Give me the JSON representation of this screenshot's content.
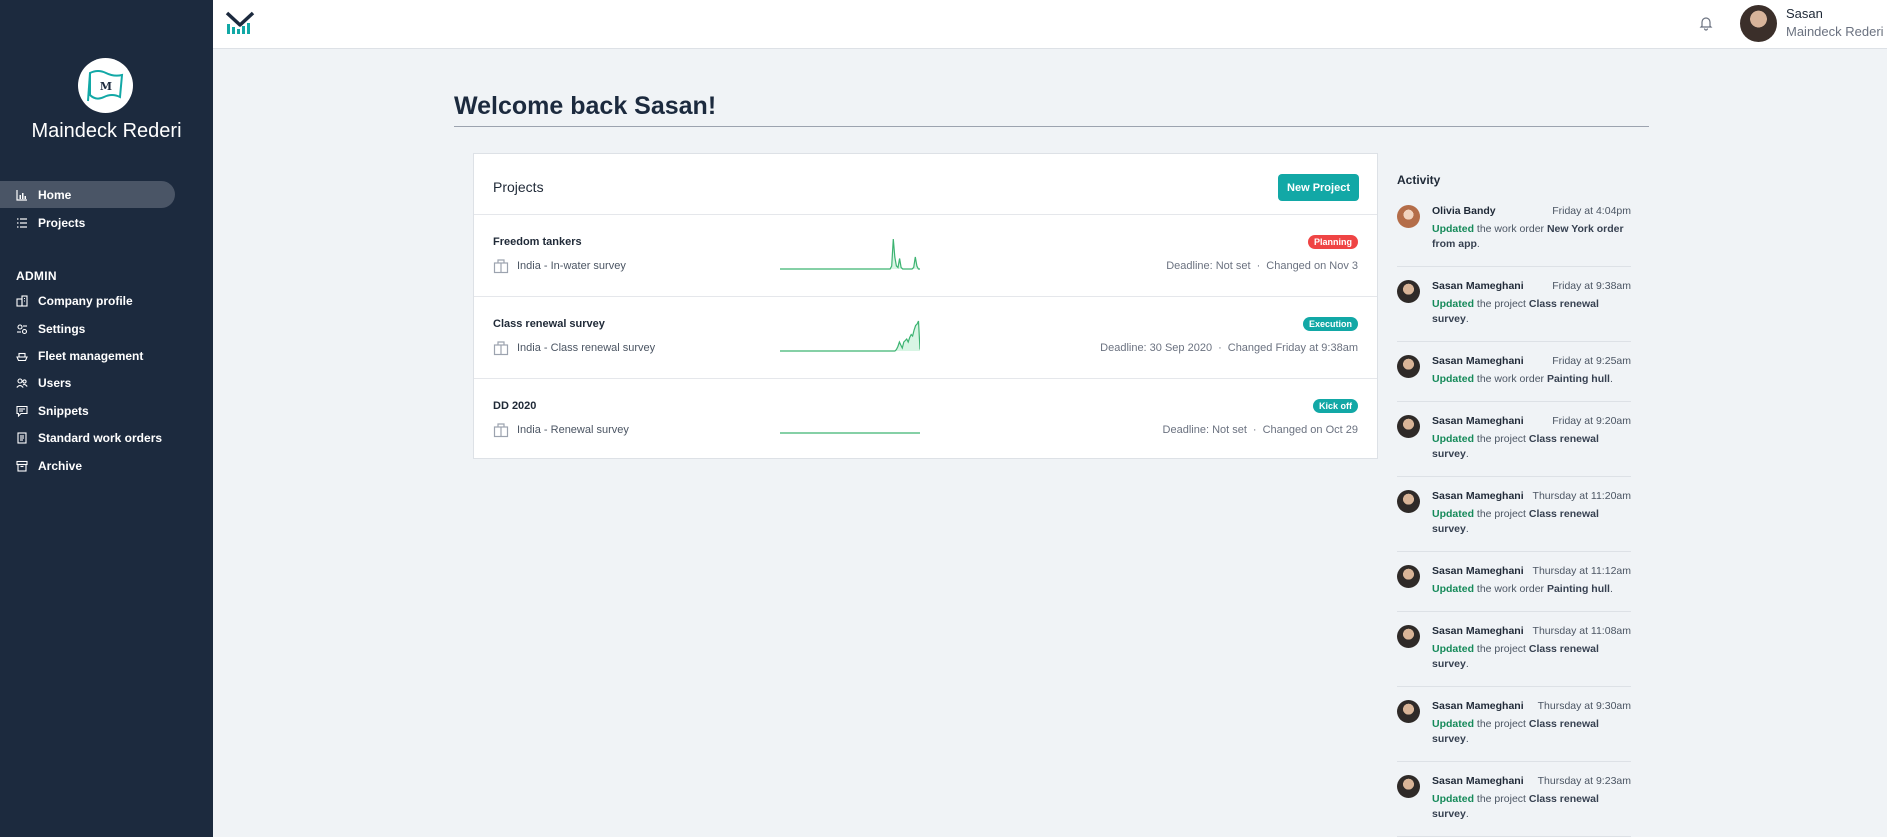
{
  "sidebar": {
    "brand_name": "Maindeck Rederi",
    "brand_letter": "M",
    "items": [
      {
        "label": "Home",
        "icon": "chart-bar-icon",
        "active": true
      },
      {
        "label": "Projects",
        "icon": "list-icon",
        "active": false
      }
    ],
    "admin_label": "ADMIN",
    "admin_items": [
      {
        "label": "Company profile",
        "icon": "building-icon"
      },
      {
        "label": "Settings",
        "icon": "settings-icon"
      },
      {
        "label": "Fleet management",
        "icon": "ship-icon"
      },
      {
        "label": "Users",
        "icon": "users-icon"
      },
      {
        "label": "Snippets",
        "icon": "message-icon"
      },
      {
        "label": "Standard work orders",
        "icon": "document-icon"
      },
      {
        "label": "Archive",
        "icon": "archive-icon"
      }
    ]
  },
  "topbar": {
    "user_name": "Sasan",
    "user_org": "Maindeck Rederi"
  },
  "welcome": "Welcome back Sasan!",
  "projects": {
    "title": "Projects",
    "new_button": "New Project",
    "rows": [
      {
        "name": "Freedom tankers",
        "subtitle": "India - In-water survey",
        "status": "Planning",
        "status_color": "#ef4444",
        "deadline": "Deadline: Not set",
        "changed": "Changed on Nov 3",
        "sparkline": [
          0,
          0,
          0,
          0,
          0,
          0,
          0,
          0,
          0,
          0,
          0,
          0,
          0,
          0,
          0,
          0,
          0,
          0,
          0,
          0,
          0,
          0,
          0,
          0,
          0,
          0,
          0,
          0,
          0,
          0,
          0,
          0,
          0,
          0,
          0,
          0,
          0,
          0,
          0,
          0,
          0,
          0,
          0,
          0,
          0,
          0,
          0,
          0,
          0,
          0,
          0,
          0,
          0,
          0,
          0,
          0,
          0,
          0,
          0,
          0,
          0,
          0,
          0,
          0,
          0,
          0,
          0,
          0,
          0,
          0,
          0,
          0.1,
          1,
          0.4,
          0.1,
          0.05,
          0.35,
          0.05,
          0,
          0,
          0,
          0,
          0,
          0,
          0,
          0.05,
          0.4,
          0.1,
          0,
          0
        ]
      },
      {
        "name": "Class renewal survey",
        "subtitle": "India - Class renewal survey",
        "status": "Execution",
        "status_color": "#12a8a6",
        "deadline": "Deadline: 30 Sep 2020",
        "changed": "Changed Friday at 9:38am",
        "sparkline": [
          0,
          0,
          0,
          0,
          0,
          0,
          0,
          0,
          0,
          0,
          0,
          0,
          0,
          0,
          0,
          0,
          0,
          0,
          0,
          0,
          0,
          0,
          0,
          0,
          0,
          0,
          0,
          0,
          0,
          0,
          0,
          0,
          0,
          0,
          0,
          0,
          0,
          0,
          0,
          0,
          0,
          0,
          0,
          0,
          0,
          0,
          0,
          0,
          0,
          0,
          0,
          0,
          0,
          0,
          0,
          0,
          0,
          0,
          0,
          0,
          0,
          0,
          0,
          0,
          0,
          0,
          0,
          0,
          0,
          0,
          0,
          0,
          0,
          0,
          0,
          0,
          0,
          0,
          0,
          0.05,
          0.15,
          0.3,
          0.2,
          0.1,
          0.3,
          0.35,
          0.4,
          0.3,
          0.45,
          0.55,
          0.5,
          0.7,
          0.85,
          0.9,
          1,
          0.05
        ]
      },
      {
        "name": "DD 2020",
        "subtitle": "India - Renewal survey",
        "status": "Kick off",
        "status_color": "#12a8a6",
        "deadline": "Deadline: Not set",
        "changed": "Changed on Oct 29",
        "sparkline": [
          0,
          0,
          0,
          0,
          0,
          0,
          0,
          0,
          0,
          0,
          0,
          0,
          0,
          0,
          0,
          0,
          0,
          0,
          0,
          0,
          0,
          0,
          0,
          0,
          0,
          0,
          0,
          0,
          0,
          0,
          0,
          0,
          0,
          0,
          0,
          0,
          0,
          0,
          0,
          0,
          0,
          0,
          0,
          0,
          0,
          0,
          0,
          0,
          0,
          0,
          0,
          0,
          0,
          0,
          0,
          0,
          0,
          0,
          0,
          0,
          0,
          0,
          0,
          0,
          0,
          0,
          0,
          0,
          0,
          0,
          0,
          0,
          0,
          0,
          0,
          0,
          0,
          0,
          0,
          0,
          0,
          0,
          0,
          0,
          0,
          0,
          0,
          0,
          0,
          0
        ]
      }
    ]
  },
  "activity": {
    "title": "Activity",
    "items": [
      {
        "name": "Olivia Bandy",
        "time": "Friday at 4:04pm",
        "avatar": "woman",
        "verb": "Updated",
        "pre": " the work order ",
        "target": "New York order from app",
        "post": "."
      },
      {
        "name": "Sasan Mameghani",
        "time": "Friday at 9:38am",
        "avatar": "man",
        "verb": "Updated",
        "pre": " the project ",
        "target": "Class renewal survey",
        "post": "."
      },
      {
        "name": "Sasan Mameghani",
        "time": "Friday at 9:25am",
        "avatar": "man",
        "verb": "Updated",
        "pre": " the work order ",
        "target": "Painting hull",
        "post": "."
      },
      {
        "name": "Sasan Mameghani",
        "time": "Friday at 9:20am",
        "avatar": "man",
        "verb": "Updated",
        "pre": " the project ",
        "target": "Class renewal survey",
        "post": "."
      },
      {
        "name": "Sasan Mameghani",
        "time": "Thursday at 11:20am",
        "avatar": "man",
        "verb": "Updated",
        "pre": " the project ",
        "target": "Class renewal survey",
        "post": "."
      },
      {
        "name": "Sasan Mameghani",
        "time": "Thursday at 11:12am",
        "avatar": "man",
        "verb": "Updated",
        "pre": " the work order ",
        "target": "Painting hull",
        "post": "."
      },
      {
        "name": "Sasan Mameghani",
        "time": "Thursday at 11:08am",
        "avatar": "man",
        "verb": "Updated",
        "pre": " the project ",
        "target": "Class renewal survey",
        "post": "."
      },
      {
        "name": "Sasan Mameghani",
        "time": "Thursday at 9:30am",
        "avatar": "man",
        "verb": "Updated",
        "pre": " the project ",
        "target": "Class renewal survey",
        "post": "."
      },
      {
        "name": "Sasan Mameghani",
        "time": "Thursday at 9:23am",
        "avatar": "man",
        "verb": "Updated",
        "pre": " the project ",
        "target": "Class renewal survey",
        "post": "."
      }
    ]
  },
  "colors": {
    "sidebar_bg": "#1c2a3e",
    "accent": "#12a8a6",
    "updated_green": "#168a5a",
    "sparkline_green": "#3cb371"
  }
}
